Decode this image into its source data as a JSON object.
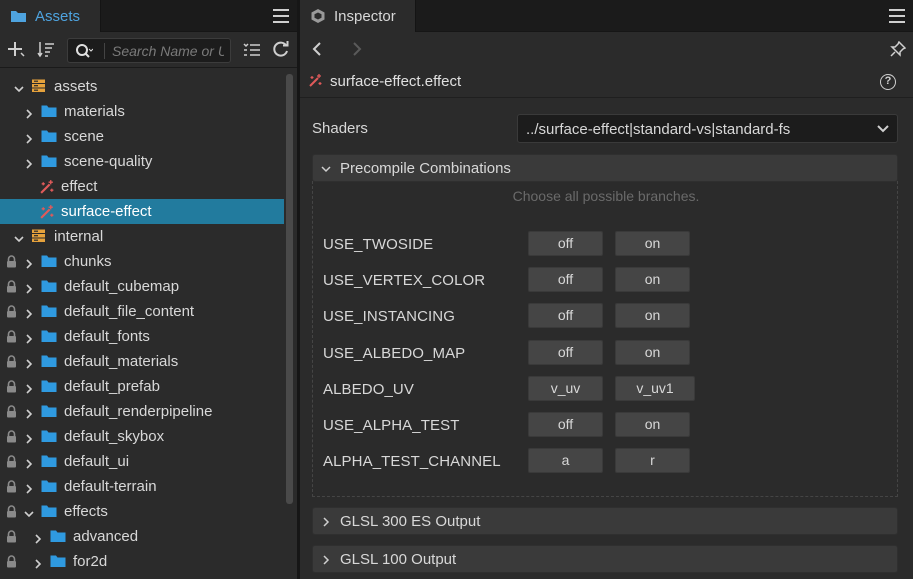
{
  "assets_panel": {
    "tab_label": "Assets",
    "search": {
      "placeholder": "Search Name or UUID"
    },
    "tree": [
      {
        "label": "assets",
        "type": "db",
        "expanded": true,
        "depth": 0,
        "locked": false
      },
      {
        "label": "materials",
        "type": "folder",
        "expanded": false,
        "depth": 1,
        "locked": false
      },
      {
        "label": "scene",
        "type": "folder",
        "expanded": false,
        "depth": 1,
        "locked": false
      },
      {
        "label": "scene-quality",
        "type": "folder",
        "expanded": false,
        "depth": 1,
        "locked": false
      },
      {
        "label": "effect",
        "type": "effect",
        "depth": 1,
        "locked": false
      },
      {
        "label": "surface-effect",
        "type": "effect",
        "depth": 1,
        "locked": false,
        "selected": true
      },
      {
        "label": "internal",
        "type": "db",
        "expanded": true,
        "depth": 0,
        "locked": false
      },
      {
        "label": "chunks",
        "type": "folder",
        "expanded": false,
        "depth": 1,
        "locked": true
      },
      {
        "label": "default_cubemap",
        "type": "folder",
        "expanded": false,
        "depth": 1,
        "locked": true
      },
      {
        "label": "default_file_content",
        "type": "folder",
        "expanded": false,
        "depth": 1,
        "locked": true
      },
      {
        "label": "default_fonts",
        "type": "folder",
        "expanded": false,
        "depth": 1,
        "locked": true
      },
      {
        "label": "default_materials",
        "type": "folder",
        "expanded": false,
        "depth": 1,
        "locked": true
      },
      {
        "label": "default_prefab",
        "type": "folder",
        "expanded": false,
        "depth": 1,
        "locked": true
      },
      {
        "label": "default_renderpipeline",
        "type": "folder",
        "expanded": false,
        "depth": 1,
        "locked": true
      },
      {
        "label": "default_skybox",
        "type": "folder",
        "expanded": false,
        "depth": 1,
        "locked": true
      },
      {
        "label": "default_ui",
        "type": "folder",
        "expanded": false,
        "depth": 1,
        "locked": true
      },
      {
        "label": "default-terrain",
        "type": "folder",
        "expanded": false,
        "depth": 1,
        "locked": true
      },
      {
        "label": "effects",
        "type": "folder",
        "expanded": true,
        "depth": 1,
        "locked": true
      },
      {
        "label": "advanced",
        "type": "folder",
        "expanded": false,
        "depth": 2,
        "locked": true
      },
      {
        "label": "for2d",
        "type": "folder",
        "expanded": false,
        "depth": 2,
        "locked": true
      }
    ]
  },
  "inspector": {
    "tab_label": "Inspector",
    "title": "surface-effect.effect",
    "shaders": {
      "label": "Shaders",
      "value": "../surface-effect|standard-vs|standard-fs"
    },
    "precompile": {
      "label": "Precompile Combinations",
      "hint": "Choose all possible branches.",
      "defines": [
        {
          "name": "USE_TWOSIDE",
          "options": [
            "off",
            "on"
          ]
        },
        {
          "name": "USE_VERTEX_COLOR",
          "options": [
            "off",
            "on"
          ]
        },
        {
          "name": "USE_INSTANCING",
          "options": [
            "off",
            "on"
          ]
        },
        {
          "name": "USE_ALBEDO_MAP",
          "options": [
            "off",
            "on"
          ]
        },
        {
          "name": "ALBEDO_UV",
          "options": [
            "v_uv",
            "v_uv1"
          ]
        },
        {
          "name": "USE_ALPHA_TEST",
          "options": [
            "off",
            "on"
          ]
        },
        {
          "name": "ALPHA_TEST_CHANNEL",
          "options": [
            "a",
            "r"
          ]
        }
      ]
    },
    "outputs": [
      {
        "label": "GLSL 300 ES Output"
      },
      {
        "label": "GLSL 100 Output"
      }
    ]
  },
  "colors": {
    "accent": "#4ea3df",
    "selection": "#227b9e",
    "folder": "#2f9ae0",
    "db_icon": "#e6a23c",
    "effect_icon": "#e05a5a"
  }
}
